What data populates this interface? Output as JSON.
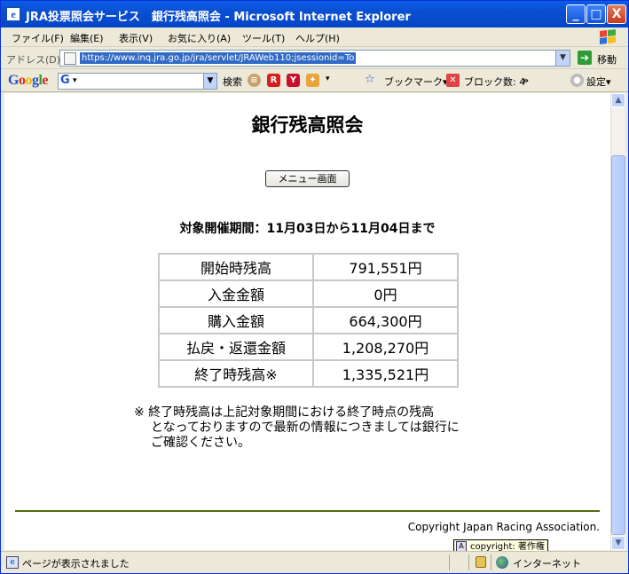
{
  "window": {
    "title": "JRA投票照会サービス　銀行残高照会 - Microsoft Internet Explorer",
    "minimize": "_",
    "maximize": "□",
    "close": "X"
  },
  "menu": [
    "ファイル(F)",
    "編集(E)",
    "表示(V)",
    "お気に入り(A)",
    "ツール(T)",
    "ヘルプ(H)"
  ],
  "address": {
    "label": "アドレス(D)",
    "url": "https://www.inq.jra.go.jp/jra/servlet/JRAWeb110;jsessionid=To",
    "go_label": "移動"
  },
  "google_toolbar": {
    "logo": "Google",
    "search_label": "検索",
    "bookmarks_label": "ブックマーク▾",
    "blocked_label": "ブロック数: 4",
    "settings_label": "設定▾"
  },
  "page": {
    "title": "銀行残高照会",
    "menu_button": "メニュー画面",
    "period": "対象開催期間：11月03日から11月04日まで",
    "rows": [
      {
        "label": "開始時残高",
        "value": "791,551円"
      },
      {
        "label": "入金金額",
        "value": "0円"
      },
      {
        "label": "購入金額",
        "value": "664,300円"
      },
      {
        "label": "払戻・返還金額",
        "value": "1,208,270円"
      },
      {
        "label": "終了時残高※",
        "value": "1,335,521円"
      }
    ],
    "note_line1": "※ 終了時残高は上記対象期間における終了時点の残高",
    "note_line2": "となっておりますので最新の情報につきましては銀行に",
    "note_line3": "ご確認ください。",
    "copyright": "Copyright Japan Racing Association."
  },
  "tooltip": "copyright: 著作権",
  "status": {
    "text": "ページが表示されました",
    "zone": "インターネット"
  }
}
